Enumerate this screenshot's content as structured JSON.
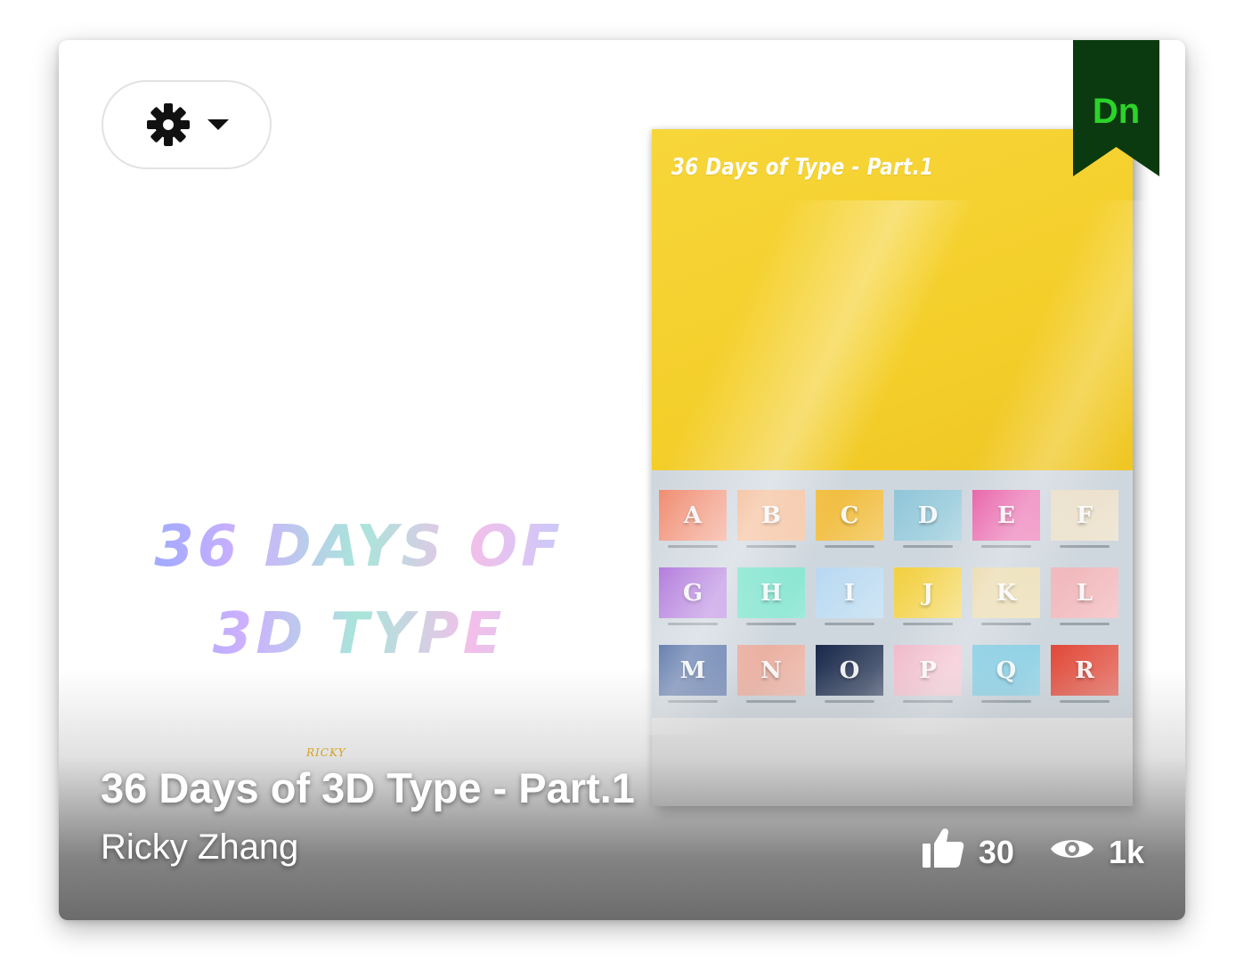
{
  "settings": {
    "gear_icon": "gear-icon",
    "caret_icon": "caret-down-icon"
  },
  "artwork": {
    "left_title": "36 DAYS OF 3D TYPE",
    "left_signature": "RICKY",
    "magazine_title": "36 Days of Type - Part.1",
    "thumbnails": [
      {
        "letter": "A",
        "color": "#f08a6e"
      },
      {
        "letter": "B",
        "color": "#f2b48a"
      },
      {
        "letter": "C",
        "color": "#f0b830"
      },
      {
        "letter": "D",
        "color": "#8fc6d8"
      },
      {
        "letter": "E",
        "color": "#e860a8"
      },
      {
        "letter": "F",
        "color": "#e8dcc4"
      },
      {
        "letter": "G",
        "color": "#a86ad8"
      },
      {
        "letter": "H",
        "color": "#6fe0c8"
      },
      {
        "letter": "I",
        "color": "#b8d8f0"
      },
      {
        "letter": "J",
        "color": "#f2d040"
      },
      {
        "letter": "K",
        "color": "#e8d8a8"
      },
      {
        "letter": "L",
        "color": "#f0b4b8"
      },
      {
        "letter": "M",
        "color": "#3a5a98"
      },
      {
        "letter": "N",
        "color": "#e8a898"
      },
      {
        "letter": "O",
        "color": "#18284a"
      },
      {
        "letter": "P",
        "color": "#f0b8c8"
      },
      {
        "letter": "Q",
        "color": "#7ac8e0"
      },
      {
        "letter": "R",
        "color": "#e04838"
      }
    ]
  },
  "badge": {
    "label": "Dn",
    "bg_color": "#0b3a10",
    "text_color": "#2cd32a"
  },
  "project": {
    "title": "36 Days of 3D Type - Part.1",
    "owner": "Ricky Zhang"
  },
  "stats": {
    "likes": "30",
    "likes_icon": "thumbs-up-icon",
    "views": "1k",
    "views_icon": "eye-icon"
  }
}
